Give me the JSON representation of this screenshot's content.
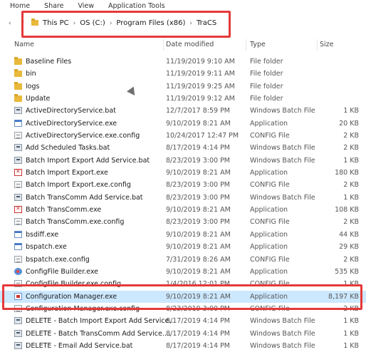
{
  "ribbon": {
    "tabs": [
      "Home",
      "Share",
      "View",
      "Application Tools"
    ]
  },
  "address": {
    "nav_back": "‹",
    "nav_up": "↑",
    "breadcrumbs": [
      "This PC",
      "OS (C:)",
      "Program Files (x86)",
      "TraCS"
    ],
    "separator": "›"
  },
  "columns": {
    "name": "Name",
    "date": "Date modified",
    "type": "Type",
    "size": "Size"
  },
  "colors": {
    "highlight_box": "#e5393a",
    "selected_row": "#cce8ff"
  },
  "files": [
    {
      "name": "Baseline Files",
      "date": "11/19/2019 9:10 AM",
      "type": "File folder",
      "size": "",
      "icon": "folder"
    },
    {
      "name": "bin",
      "date": "11/19/2019 9:11 AM",
      "type": "File folder",
      "size": "",
      "icon": "folder"
    },
    {
      "name": "logs",
      "date": "11/19/2019 9:25 AM",
      "type": "File folder",
      "size": "",
      "icon": "folder"
    },
    {
      "name": "Update",
      "date": "11/19/2019 9:12 AM",
      "type": "File folder",
      "size": "",
      "icon": "folder"
    },
    {
      "name": "ActiveDirectoryService.bat",
      "date": "12/7/2017 8:59 PM",
      "type": "Windows Batch File",
      "size": "1 KB",
      "icon": "bat"
    },
    {
      "name": "ActiveDirectoryService.exe",
      "date": "9/10/2019 8:21 AM",
      "type": "Application",
      "size": "20 KB",
      "icon": "exe"
    },
    {
      "name": "ActiveDirectoryService.exe.config",
      "date": "10/24/2017 12:47 PM",
      "type": "CONFIG File",
      "size": "2 KB",
      "icon": "config"
    },
    {
      "name": "Add Scheduled Tasks.bat",
      "date": "8/17/2019 4:14 PM",
      "type": "Windows Batch File",
      "size": "2 KB",
      "icon": "bat"
    },
    {
      "name": "Batch Import Export Add Service.bat",
      "date": "8/23/2019 3:00 PM",
      "type": "Windows Batch File",
      "size": "1 KB",
      "icon": "bat"
    },
    {
      "name": "Batch Import Export.exe",
      "date": "9/10/2019 8:21 AM",
      "type": "Application",
      "size": "180 KB",
      "icon": "exe-red"
    },
    {
      "name": "Batch Import Export.exe.config",
      "date": "8/23/2019 3:00 PM",
      "type": "CONFIG File",
      "size": "2 KB",
      "icon": "config"
    },
    {
      "name": "Batch TransComm Add Service.bat",
      "date": "8/23/2019 3:00 PM",
      "type": "Windows Batch File",
      "size": "1 KB",
      "icon": "bat"
    },
    {
      "name": "Batch TransComm.exe",
      "date": "9/10/2019 8:21 AM",
      "type": "Application",
      "size": "108 KB",
      "icon": "exe-red"
    },
    {
      "name": "Batch TransComm.exe.config",
      "date": "8/23/2019 3:00 PM",
      "type": "CONFIG File",
      "size": "2 KB",
      "icon": "config"
    },
    {
      "name": "bsdiff.exe",
      "date": "9/10/2019 8:21 AM",
      "type": "Application",
      "size": "44 KB",
      "icon": "exe"
    },
    {
      "name": "bspatch.exe",
      "date": "9/10/2019 8:21 AM",
      "type": "Application",
      "size": "29 KB",
      "icon": "exe"
    },
    {
      "name": "bspatch.exe.config",
      "date": "7/31/2019 8:26 AM",
      "type": "CONFIG File",
      "size": "2 KB",
      "icon": "config"
    },
    {
      "name": "ConfigFile Builder.exe",
      "date": "9/10/2019 8:21 AM",
      "type": "Application",
      "size": "535 KB",
      "icon": "exe-globe"
    },
    {
      "name": "ConfigFile Builder.exe.config",
      "date": "1/4/2016 12:01 PM",
      "type": "CONFIG File",
      "size": "1 KB",
      "icon": "config"
    },
    {
      "name": "Configuration Manager.exe",
      "date": "9/10/2019 8:21 AM",
      "type": "Application",
      "size": "8,197 KB",
      "icon": "exe-cm",
      "selected": true
    },
    {
      "name": "Configuration Manager.exe.config",
      "date": "8/23/2019 3:00 PM",
      "type": "CONFIG File",
      "size": "2 KB",
      "icon": "config"
    },
    {
      "name": "DELETE - Batch Import Export Add Service...",
      "date": "8/17/2019 4:14 PM",
      "type": "Windows Batch File",
      "size": "1 KB",
      "icon": "bat"
    },
    {
      "name": "DELETE - Batch TransComm Add Service....",
      "date": "8/17/2019 4:14 PM",
      "type": "Windows Batch File",
      "size": "1 KB",
      "icon": "bat"
    },
    {
      "name": "DELETE - Email Add Service.bat",
      "date": "8/17/2019 4:14 PM",
      "type": "Windows Batch File",
      "size": "1 KB",
      "icon": "bat"
    }
  ]
}
